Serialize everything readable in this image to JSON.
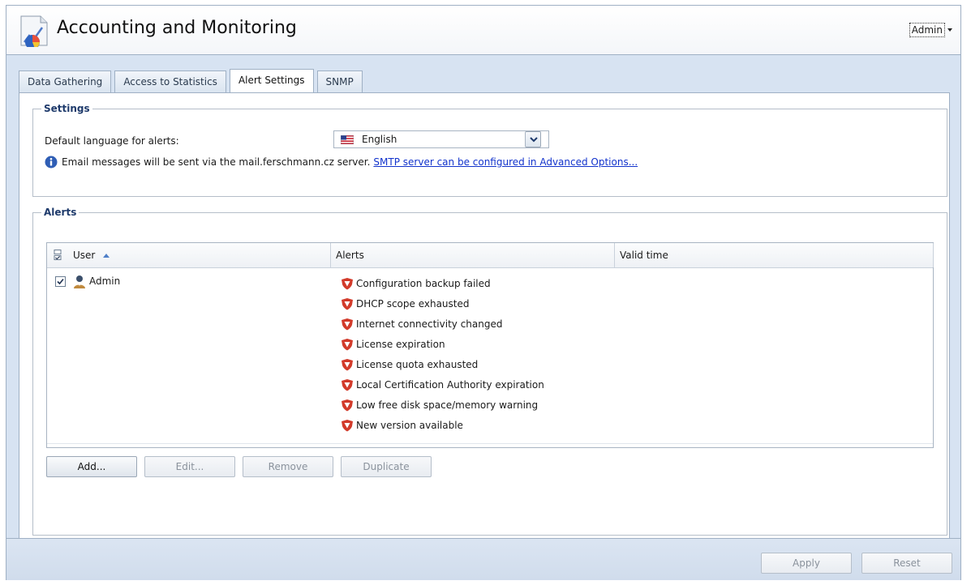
{
  "app": {
    "title": "Accounting and Monitoring",
    "user": "Admin"
  },
  "tabs": [
    {
      "label": "Data Gathering",
      "active": false
    },
    {
      "label": "Access to Statistics",
      "active": false
    },
    {
      "label": "Alert Settings",
      "active": true
    },
    {
      "label": "SNMP",
      "active": false
    }
  ],
  "settings": {
    "legend": "Settings",
    "language_label": "Default language for alerts:",
    "language_value": "English",
    "language_flag_icon": "us-flag-icon",
    "info_text": "Email messages will be sent via the mail.ferschmann.cz server.",
    "info_link": "SMTP server can be configured in Advanced Options..."
  },
  "alerts": {
    "legend": "Alerts",
    "columns": {
      "user": "User",
      "alerts": "Alerts",
      "valid_time": "Valid time"
    },
    "rows": [
      {
        "checked": true,
        "user": "Admin",
        "valid_time": "",
        "alerts": [
          "Configuration backup failed",
          "DHCP scope exhausted",
          "Internet connectivity changed",
          "License expiration",
          "License quota exhausted",
          "Local Certification Authority expiration",
          "Low free disk space/memory warning",
          "New version available"
        ]
      }
    ],
    "buttons": {
      "add": "Add...",
      "edit": "Edit...",
      "remove": "Remove",
      "duplicate": "Duplicate"
    }
  },
  "footer": {
    "apply": "Apply",
    "reset": "Reset"
  },
  "colors": {
    "accent": "#d7e3f2",
    "link": "#1233cc",
    "alert_shield": "#d23a2a"
  }
}
